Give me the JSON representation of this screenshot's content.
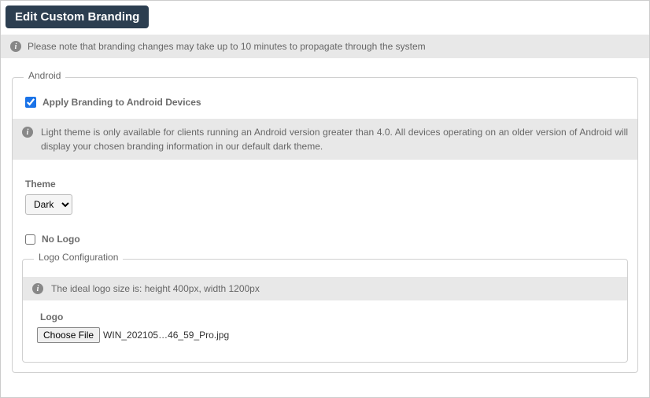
{
  "header": {
    "title": "Edit Custom Branding"
  },
  "banner": {
    "note": "Please note that branding changes may take up to 10 minutes to propagate through the system"
  },
  "android": {
    "legend": "Android",
    "apply_checkbox_label": "Apply Branding to Android Devices",
    "apply_checked": true,
    "light_theme_note": "Light theme is only available for clients running an Android version greater than 4.0. All devices operating on an older version of Android will display your chosen branding information in our default dark theme.",
    "theme_label": "Theme",
    "theme_value": "Dark",
    "nologo_label": "No Logo",
    "nologo_checked": false,
    "logo_config": {
      "legend": "Logo Configuration",
      "ideal_note": "The ideal logo size is: height 400px, width 1200px",
      "logo_label": "Logo",
      "choose_file_label": "Choose File",
      "filename": "WIN_202105…46_59_Pro.jpg"
    }
  }
}
